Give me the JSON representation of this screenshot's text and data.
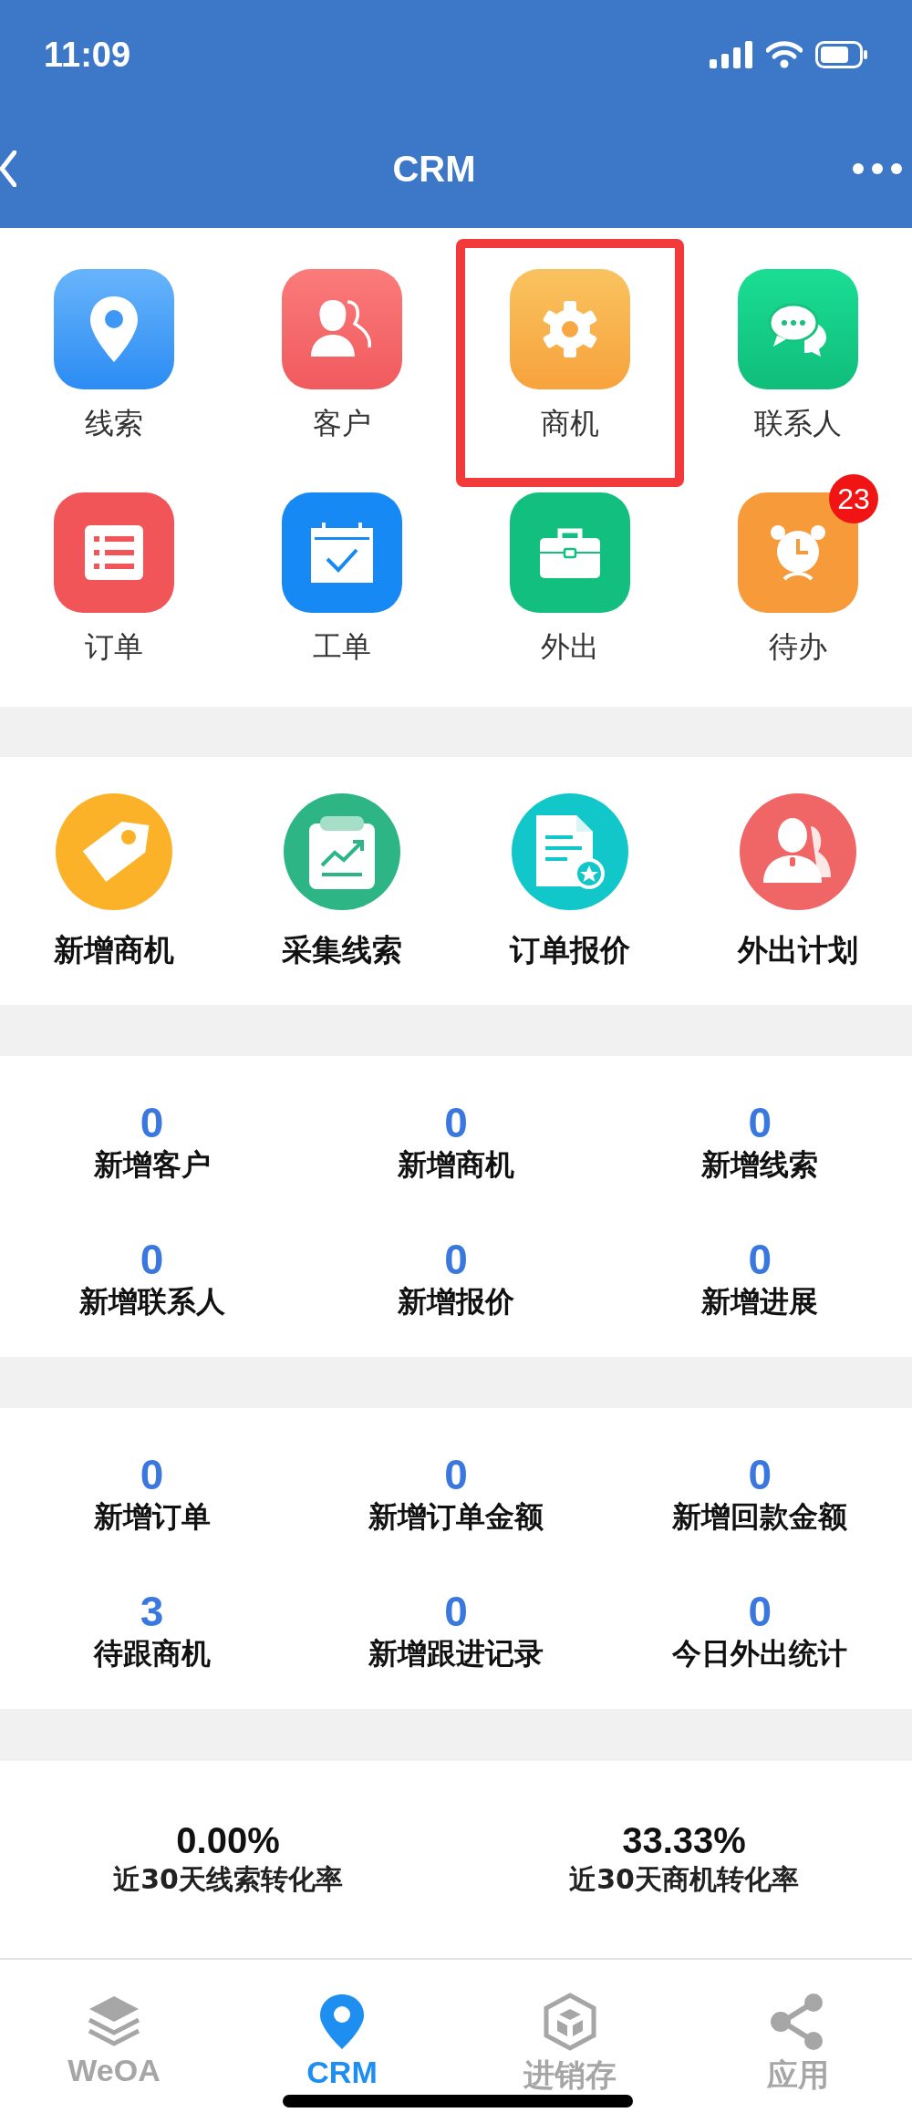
{
  "status_bar": {
    "time": "11:09"
  },
  "nav_bar": {
    "title": "CRM"
  },
  "modules": [
    {
      "label": "线索",
      "highlighted": false
    },
    {
      "label": "客户",
      "highlighted": false
    },
    {
      "label": "商机",
      "highlighted": true
    },
    {
      "label": "联系人",
      "highlighted": false
    },
    {
      "label": "订单",
      "highlighted": false
    },
    {
      "label": "工单",
      "highlighted": false
    },
    {
      "label": "外出",
      "highlighted": false
    },
    {
      "label": "待办",
      "highlighted": false,
      "badge": "23"
    }
  ],
  "quick_actions": [
    {
      "label": "新增商机"
    },
    {
      "label": "采集线索"
    },
    {
      "label": "订单报价"
    },
    {
      "label": "外出计划"
    }
  ],
  "stat_groups": [
    [
      {
        "value": "0",
        "label": "新增客户"
      },
      {
        "value": "0",
        "label": "新增商机"
      },
      {
        "value": "0",
        "label": "新增线索"
      },
      {
        "value": "0",
        "label": "新增联系人"
      },
      {
        "value": "0",
        "label": "新增报价"
      },
      {
        "value": "0",
        "label": "新增进展"
      }
    ],
    [
      {
        "value": "0",
        "label": "新增订单"
      },
      {
        "value": "0",
        "label": "新增订单金额"
      },
      {
        "value": "0",
        "label": "新增回款金额"
      },
      {
        "value": "3",
        "label": "待跟商机"
      },
      {
        "value": "0",
        "label": "新增跟进记录"
      },
      {
        "value": "0",
        "label": "今日外出统计"
      }
    ]
  ],
  "rates": [
    {
      "value": "0.00%",
      "label": "近30天线索转化率"
    },
    {
      "value": "33.33%",
      "label": "近30天商机转化率"
    }
  ],
  "tabs": [
    {
      "label": "WeOA",
      "selected": false
    },
    {
      "label": "CRM",
      "selected": true
    },
    {
      "label": "进销存",
      "selected": false
    },
    {
      "label": "应用",
      "selected": false
    }
  ]
}
